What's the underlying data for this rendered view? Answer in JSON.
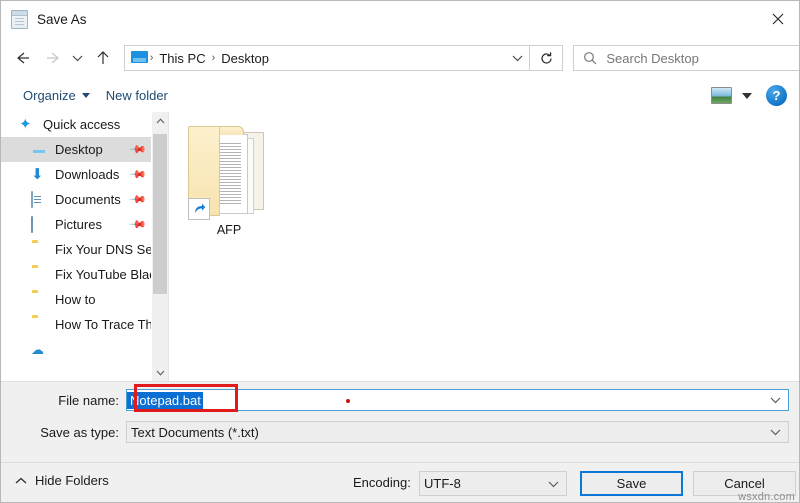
{
  "window": {
    "title": "Save As",
    "title_icon": "notepad-icon",
    "close_label": "✕"
  },
  "nav": {
    "back_icon": "arrow-left-icon",
    "forward_icon": "arrow-right-icon",
    "recent_icon": "chevron-down-icon",
    "up_icon": "arrow-up-icon",
    "refresh_icon": "refresh-icon",
    "address": {
      "location_icon": "this-pc-icon",
      "crumbs": [
        "This PC",
        "Desktop"
      ],
      "separator": "›",
      "dropdown_icon": "chevron-down-icon"
    },
    "search": {
      "icon": "search-icon",
      "placeholder": "Search Desktop",
      "value": ""
    }
  },
  "toolbar": {
    "organize_label": "Organize",
    "new_folder_label": "New folder",
    "view_icon": "view-options-icon",
    "view_caret_icon": "chevron-down-icon",
    "help_label": "?"
  },
  "sidebar": {
    "items": [
      {
        "label": "Quick access",
        "icon": "star-icon",
        "indent": false,
        "selected": false,
        "pinned": false
      },
      {
        "label": "Desktop",
        "icon": "desktop-icon",
        "indent": true,
        "selected": true,
        "pinned": true
      },
      {
        "label": "Downloads",
        "icon": "download-icon",
        "indent": true,
        "selected": false,
        "pinned": true
      },
      {
        "label": "Documents",
        "icon": "documents-icon",
        "indent": true,
        "selected": false,
        "pinned": true
      },
      {
        "label": "Pictures",
        "icon": "pictures-icon",
        "indent": true,
        "selected": false,
        "pinned": true
      },
      {
        "label": "Fix Your DNS Ser",
        "icon": "folder-icon",
        "indent": true,
        "selected": false,
        "pinned": false
      },
      {
        "label": "Fix YouTube Blac",
        "icon": "folder-icon",
        "indent": true,
        "selected": false,
        "pinned": false
      },
      {
        "label": "How to",
        "icon": "folder-icon",
        "indent": true,
        "selected": false,
        "pinned": false
      },
      {
        "label": "How To Trace Th",
        "icon": "folder-icon",
        "indent": true,
        "selected": false,
        "pinned": false
      }
    ],
    "scroll_up_icon": "chevron-up-icon",
    "scroll_down_icon": "chevron-down-icon"
  },
  "content": {
    "files": [
      {
        "name": "AFP",
        "icon": "folder-shortcut-icon"
      }
    ]
  },
  "form": {
    "file_name_label": "File name:",
    "file_name_value": "Notepad.bat",
    "file_name_chevron": "chevron-down-icon",
    "save_as_type_label": "Save as type:",
    "save_as_type_value": "Text Documents (*.txt)",
    "save_as_type_chevron": "chevron-down-icon",
    "annotation_color": "#e01b1b"
  },
  "footer": {
    "hide_folders_label": "Hide Folders",
    "hide_folders_icon": "chevron-up-icon",
    "encoding_label": "Encoding:",
    "encoding_value": "UTF-8",
    "encoding_chevron": "chevron-down-icon",
    "save_label": "Save",
    "cancel_label": "Cancel",
    "watermark": "wsxdn.com"
  },
  "colors": {
    "accent": "#0a78d4",
    "selection": "#0b6fd4",
    "annotation": "#e01b1b",
    "toolbar_text": "#1f4b73"
  }
}
